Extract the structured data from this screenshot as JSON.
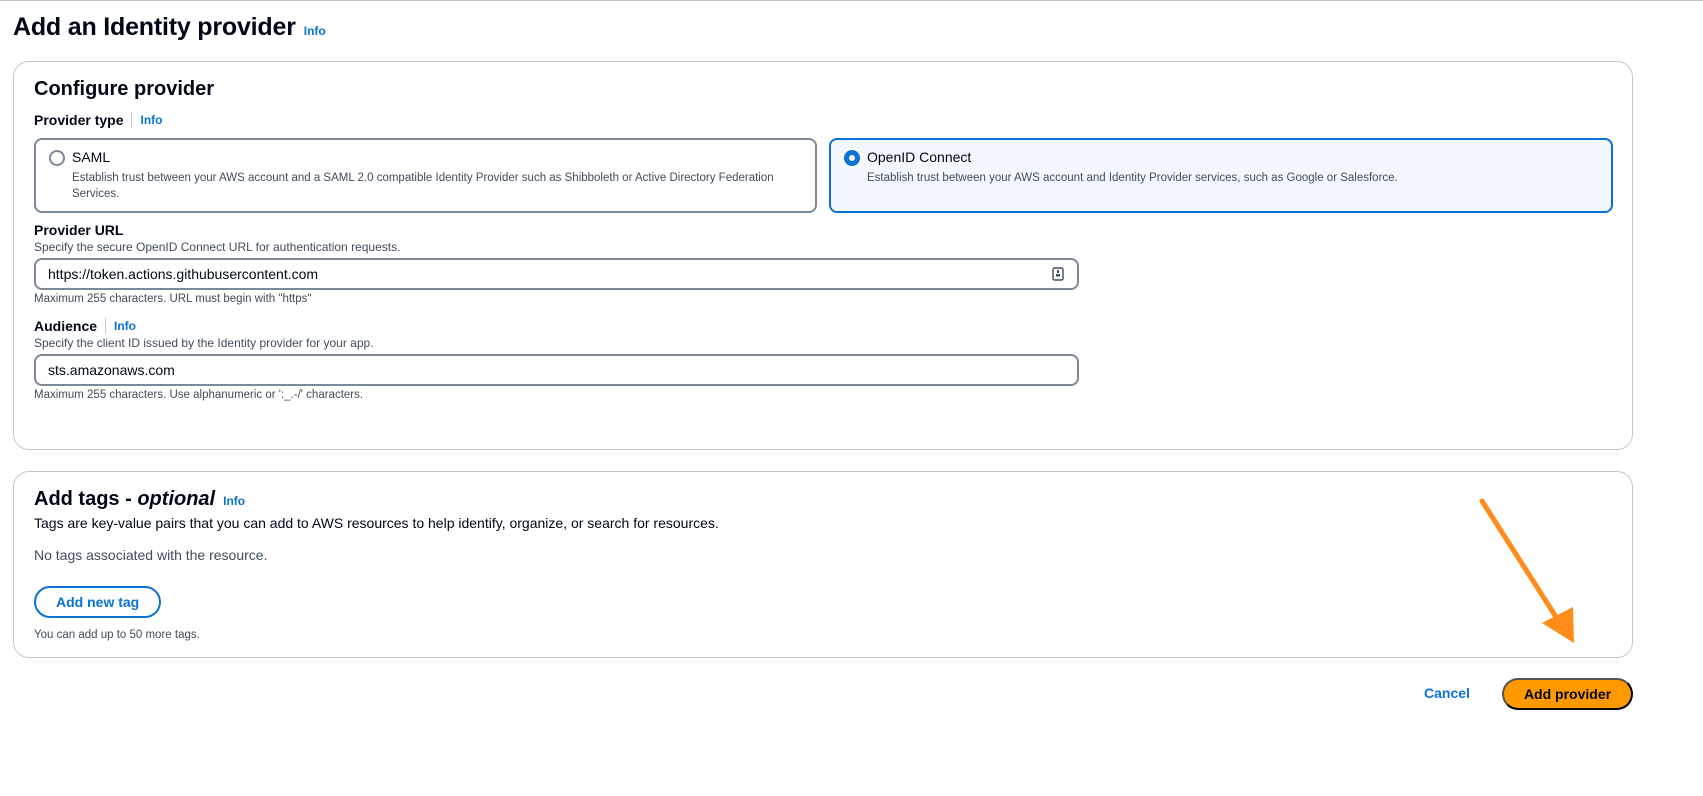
{
  "page": {
    "title": "Add an Identity provider",
    "info_label": "Info"
  },
  "configure": {
    "heading": "Configure provider",
    "provider_type": {
      "label": "Provider type",
      "info_label": "Info",
      "options": [
        {
          "title": "SAML",
          "description": "Establish trust between your AWS account and a SAML 2.0 compatible Identity Provider such as Shibboleth or Active Directory Federation Services.",
          "selected": false
        },
        {
          "title": "OpenID Connect",
          "description": "Establish trust between your AWS account and Identity Provider services, such as Google or Salesforce.",
          "selected": true
        }
      ]
    },
    "provider_url": {
      "label": "Provider URL",
      "description": "Specify the secure OpenID Connect URL for authentication requests.",
      "value": "https://token.actions.githubusercontent.com",
      "hint": "Maximum 255 characters. URL must begin with \"https\""
    },
    "audience": {
      "label": "Audience",
      "info_label": "Info",
      "description": "Specify the client ID issued by the Identity provider for your app.",
      "value": "sts.amazonaws.com",
      "hint": "Maximum 255 characters. Use alphanumeric or ':_.-/' characters."
    }
  },
  "tags": {
    "heading": "Add tags - ",
    "heading_optional": "optional",
    "info_label": "Info",
    "description": "Tags are key-value pairs that you can add to AWS resources to help identify, organize, or search for resources.",
    "empty_message": "No tags associated with the resource.",
    "add_button": "Add new tag",
    "limit_hint": "You can add up to 50 more tags."
  },
  "footer": {
    "cancel_label": "Cancel",
    "submit_label": "Add provider"
  },
  "colors": {
    "accent": "#0972d3",
    "primary_button": "#ff9900",
    "annotation_arrow": "#ff8c1a"
  },
  "icons": {
    "url_field": "clipboard-icon",
    "annotation": "arrow-pointing-icon"
  }
}
